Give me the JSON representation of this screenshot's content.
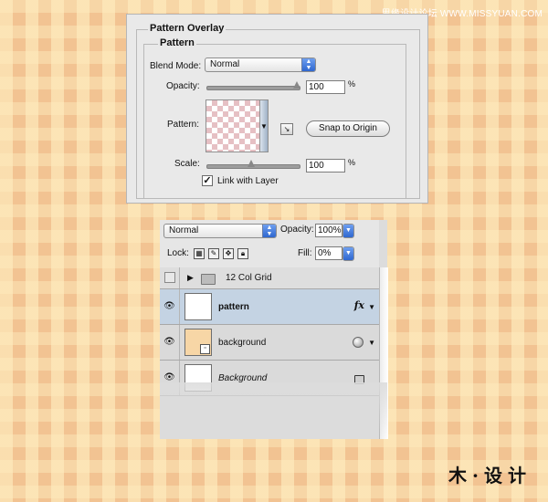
{
  "watermark": "思缘设计论坛 WWW.MISSYUAN.COM",
  "brand": "木·设计",
  "dialog": {
    "section_title": "Pattern Overlay",
    "group_title": "Pattern",
    "blend_mode_label": "Blend Mode:",
    "blend_mode_value": "Normal",
    "opacity_label": "Opacity:",
    "opacity_value": "100",
    "opacity_percent": 100,
    "opacity_unit": "%",
    "pattern_label": "Pattern:",
    "snap_button": "Snap to Origin",
    "scale_label": "Scale:",
    "scale_value": "100",
    "scale_unit": "%",
    "link_with_layer_label": "Link with Layer",
    "link_with_layer_checked": true
  },
  "layers_panel": {
    "blend_mode_value": "Normal",
    "opacity_label": "Opacity:",
    "opacity_value": "100%",
    "lock_label": "Lock:",
    "fill_label": "Fill:",
    "fill_value": "0%",
    "layers": [
      {
        "name": "12 Col Grid",
        "type": "group",
        "visible": false
      },
      {
        "name": "pattern",
        "type": "layer",
        "visible": true,
        "selected": true,
        "fx": "fx",
        "thumb_color": "#ffffff"
      },
      {
        "name": "background",
        "type": "smart-object",
        "visible": true,
        "thumb_color": "#f7d6a6"
      },
      {
        "name": "Background",
        "type": "locked",
        "visible": true,
        "thumb_color": "#ffffff"
      }
    ]
  },
  "colors": {
    "selected_row": "#c4d3e3",
    "page_background": "#f7d6a6"
  }
}
